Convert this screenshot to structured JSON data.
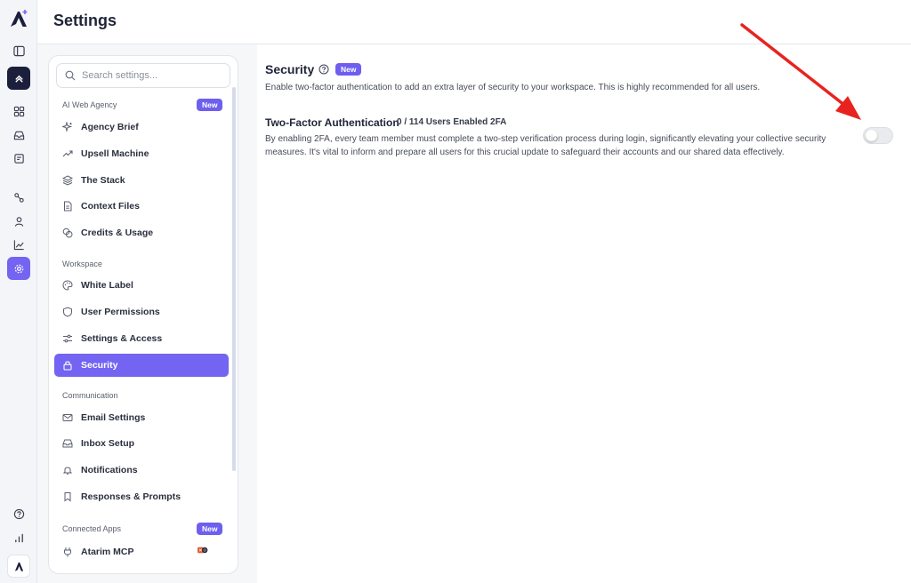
{
  "header": {
    "title": "Settings"
  },
  "rail": {
    "items": [
      "logo-icon",
      "sidebar-toggle-icon",
      "home-icon",
      "grid-icon",
      "inbox-icon",
      "calendar-icon",
      "routes-icon",
      "user-icon",
      "chart-icon",
      "settings-icon",
      "help-icon",
      "stats-icon",
      "brand-icon"
    ]
  },
  "panel": {
    "search_placeholder": "Search settings...",
    "sections": [
      {
        "title": "AI Web Agency",
        "badge": "New",
        "items": [
          "Agency Brief",
          "Upsell Machine",
          "The Stack",
          "Context Files",
          "Credits & Usage"
        ]
      },
      {
        "title": "Workspace",
        "items": [
          "White Label",
          "User Permissions",
          "Settings & Access",
          "Security"
        ]
      },
      {
        "title": "Communication",
        "items": [
          "Email Settings",
          "Inbox Setup",
          "Notifications",
          "Responses & Prompts"
        ]
      },
      {
        "title": "Connected Apps",
        "badge": "New",
        "items": [
          "Atarim MCP"
        ]
      }
    ],
    "selected": "Security"
  },
  "main": {
    "title": "Security",
    "title_badge": "New",
    "description": "Enable two-factor authentication to add an extra layer of security to your workspace. This is highly recommended for all users.",
    "tfa": {
      "title": "Two-Factor Authentication",
      "count": "0 / 114 Users Enabled 2FA",
      "description": "By enabling 2FA, every team member must complete a two-step verification process during login, significantly elevating your collective security measures. It's vital to inform and prepare all users for this crucial update to safeguard their accounts and our shared data effectively.",
      "enabled": false
    }
  },
  "colors": {
    "accent": "#7464f2",
    "rail_dark": "#1c1f3b",
    "annotation_arrow": "#e8231f"
  }
}
